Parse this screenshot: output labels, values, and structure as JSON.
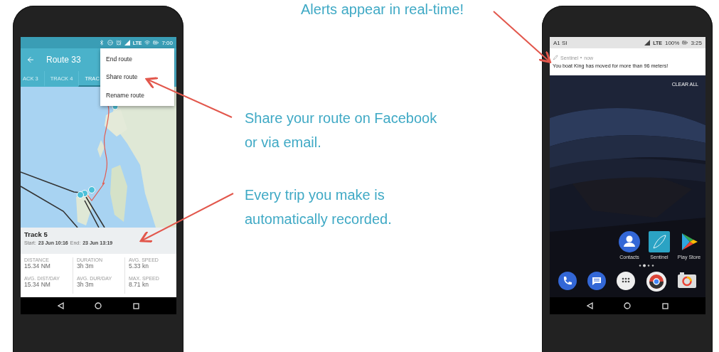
{
  "alert_caption": "Alerts appear in real-time!",
  "callouts": [
    "Share your route on Facebook or via email.",
    "Every trip you make is automatically recorded."
  ],
  "route_phone": {
    "status_bar": {
      "network": "LTE",
      "time": "7:00"
    },
    "toolbar": {
      "title": "Route 33"
    },
    "tabs": [
      {
        "label": "ACK 3",
        "selected": false
      },
      {
        "label": "TRACK 4",
        "selected": false
      },
      {
        "label": "TRAC",
        "selected": true
      }
    ],
    "menu": [
      "End route",
      "Share route",
      "Rename route"
    ],
    "track": {
      "title": "Track 5",
      "start_label": "Start:",
      "start": "23 Jun 10:16",
      "end_label": "End:",
      "end": "23 Jun 13:19"
    },
    "stats": [
      {
        "label": "DISTANCE",
        "value": "15.34 NM"
      },
      {
        "label": "AVG. DIST/DAY",
        "value": "15.34 NM"
      },
      {
        "label": "DURATION",
        "value": "3h 3m"
      },
      {
        "label": "AVG. DUR/DAY",
        "value": "3h 3m"
      },
      {
        "label": "AVG. SPEED",
        "value": "5.33 kn"
      },
      {
        "label": "MAX. SPEED",
        "value": "8.71 kn"
      }
    ]
  },
  "home_phone": {
    "status_bar": {
      "carrier": "A1 SI",
      "network": "LTE",
      "battery": "100%",
      "time": "3:25"
    },
    "notification": {
      "app": "Sentinel",
      "time": "now",
      "message": "You boat King has moved for more than 96 meters!"
    },
    "clear_all": "CLEAR ALL",
    "apps": [
      {
        "kind": "contacts",
        "label": "Contacts"
      },
      {
        "kind": "sentinel",
        "label": "Sentinel"
      },
      {
        "kind": "play",
        "label": "Play Store"
      }
    ],
    "dock": [
      {
        "kind": "phone"
      },
      {
        "kind": "messages"
      },
      {
        "kind": "apps"
      },
      {
        "kind": "chrome"
      },
      {
        "kind": "camera"
      }
    ]
  }
}
